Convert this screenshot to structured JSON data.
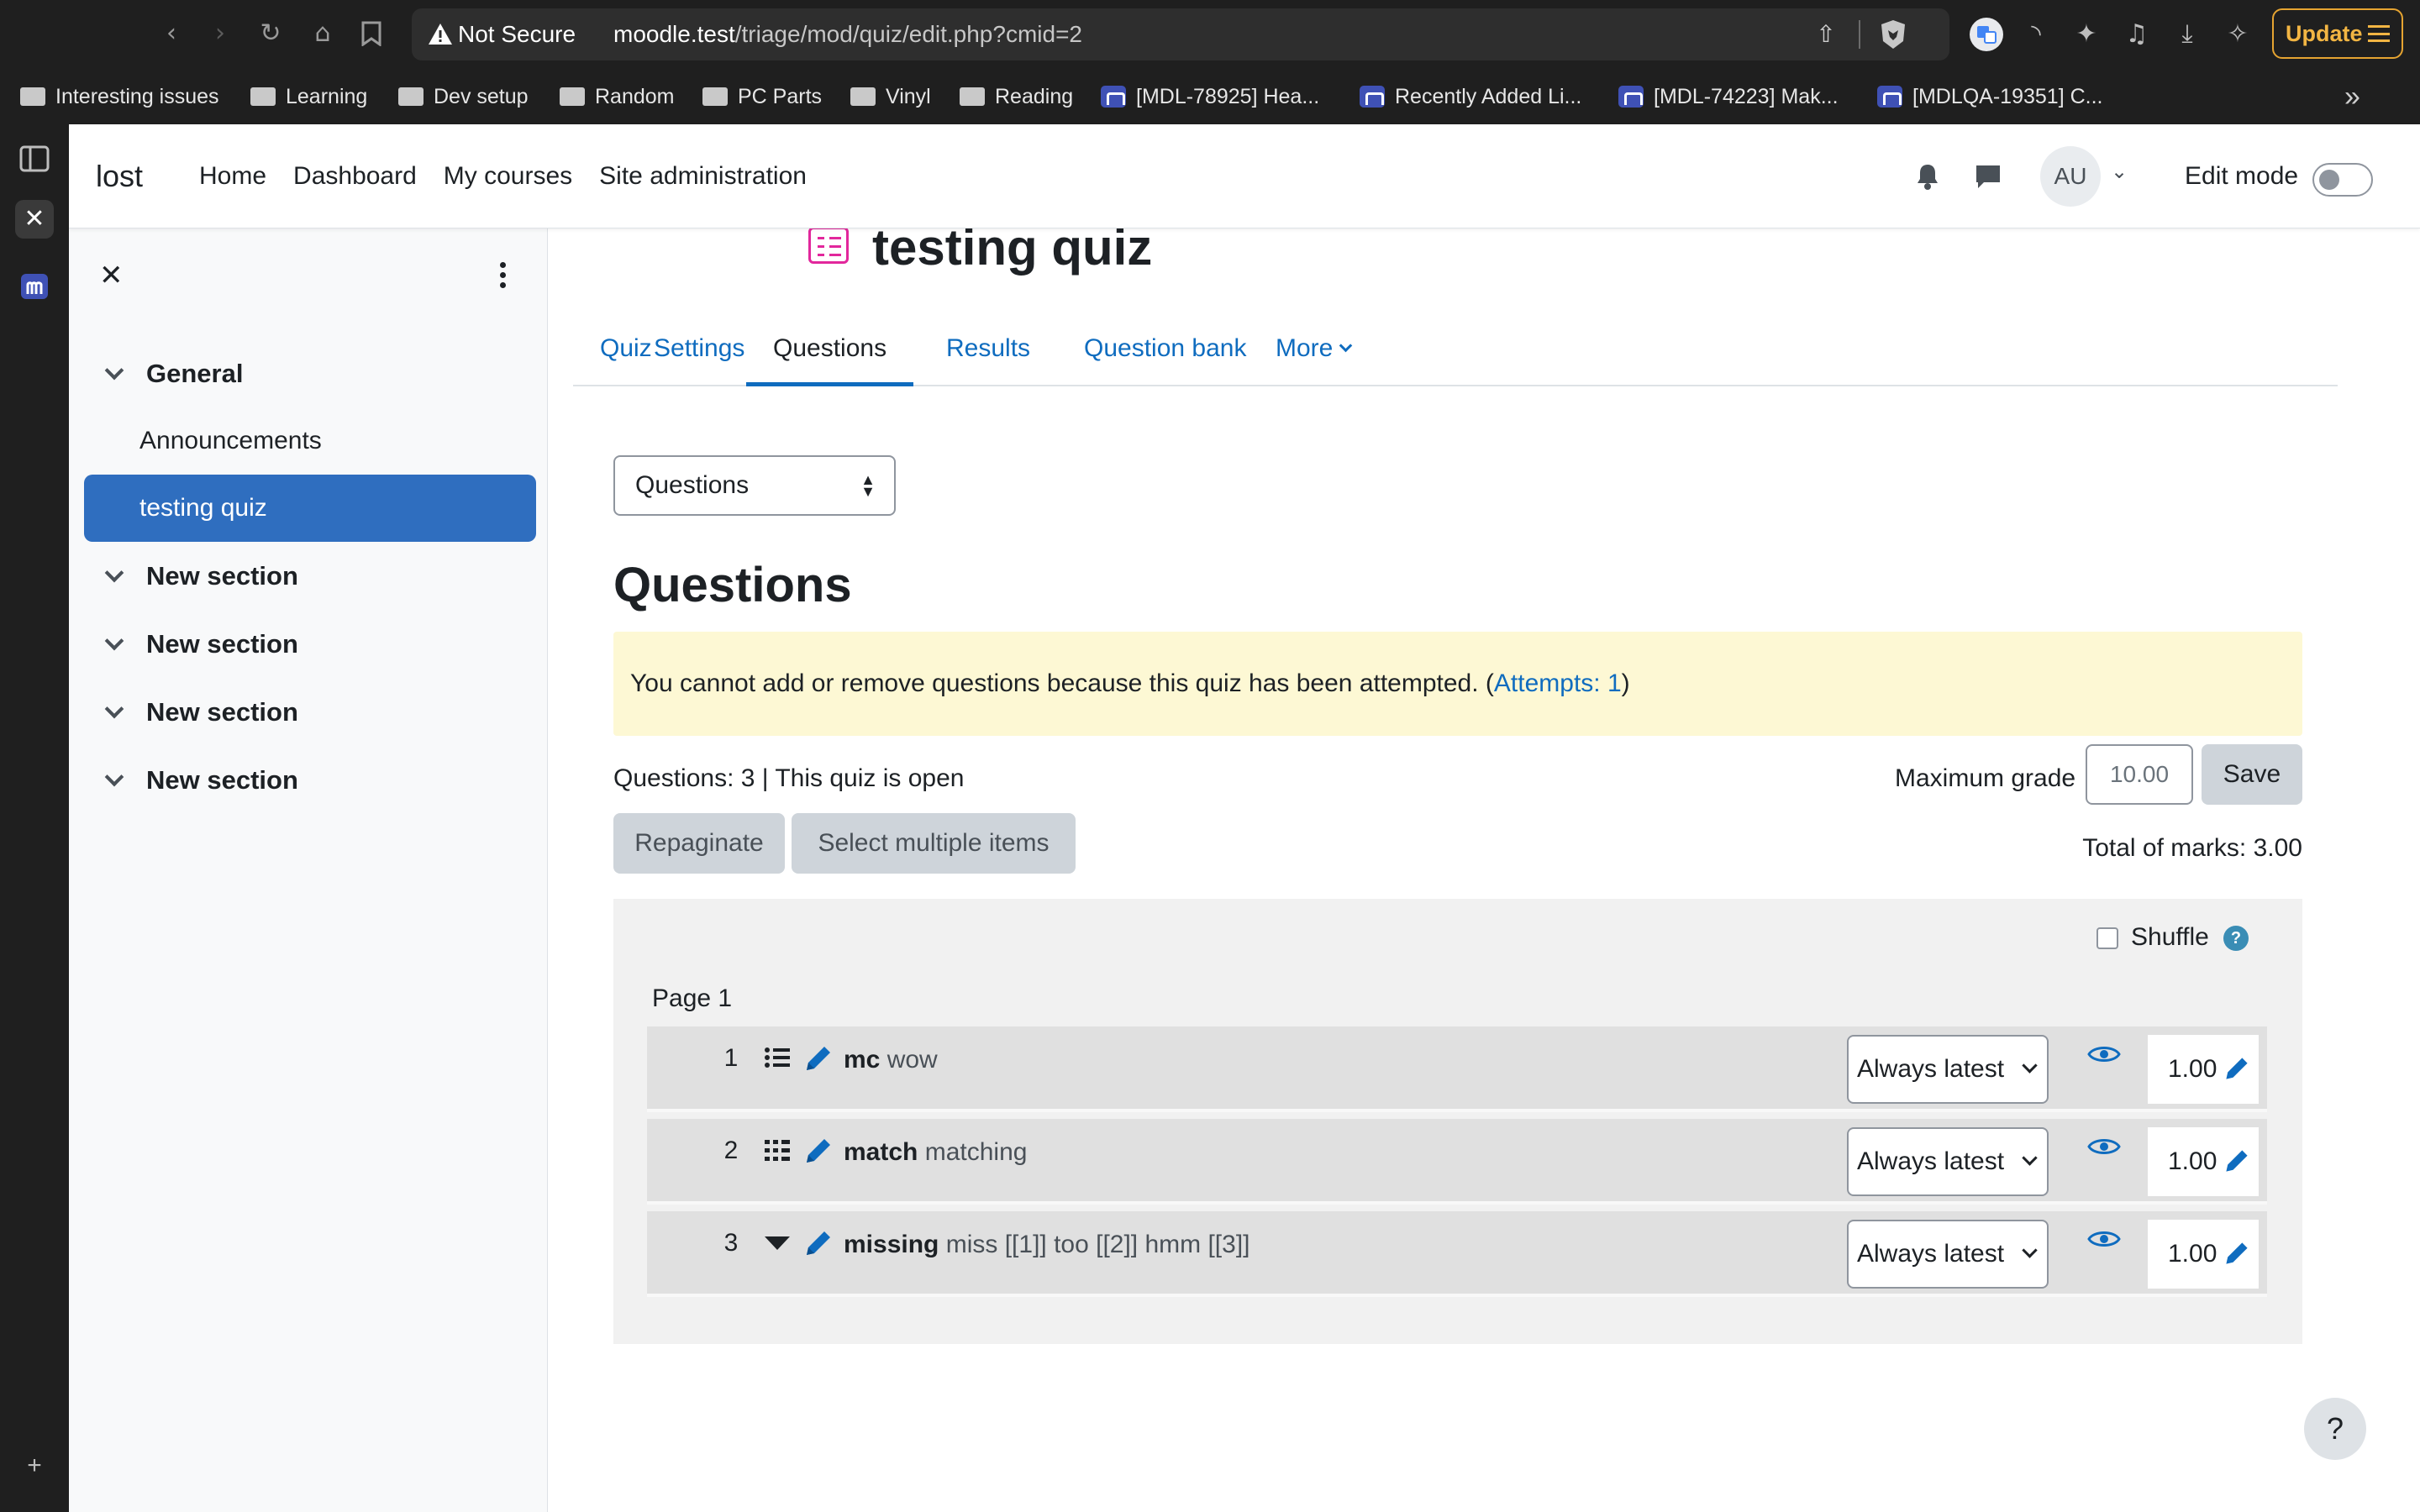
{
  "browser": {
    "not_secure_label": "Not Secure",
    "url_host": "moodle.test",
    "url_path": "/triage/mod/quiz/edit.php?cmid=2",
    "update_label": "Update",
    "bookmarks": [
      {
        "label": "Interesting issues",
        "icon": "folder-icon"
      },
      {
        "label": "Learning",
        "icon": "folder-icon"
      },
      {
        "label": "Dev setup",
        "icon": "folder-icon"
      },
      {
        "label": "Random",
        "icon": "folder-icon"
      },
      {
        "label": "PC Parts",
        "icon": "folder-icon"
      },
      {
        "label": "Vinyl",
        "icon": "folder-icon"
      },
      {
        "label": "Reading",
        "icon": "folder-icon"
      },
      {
        "label": "[MDL-78925] Hea...",
        "icon": "moodle-icon"
      },
      {
        "label": "Recently Added Li...",
        "icon": "moodle-icon"
      },
      {
        "label": "[MDL-74223] Mak...",
        "icon": "moodle-icon"
      },
      {
        "label": "[MDLQA-19351] C...",
        "icon": "moodle-icon"
      }
    ]
  },
  "navbar": {
    "brand": "lost",
    "links": [
      "Home",
      "Dashboard",
      "My courses",
      "Site administration"
    ],
    "avatar_initials": "AU",
    "edit_mode_label": "Edit mode",
    "edit_mode_on": false
  },
  "course_index": {
    "sections": [
      {
        "title": "General",
        "activities": [
          "Announcements",
          "testing quiz"
        ]
      },
      {
        "title": "New section",
        "activities": []
      },
      {
        "title": "New section",
        "activities": []
      },
      {
        "title": "New section",
        "activities": []
      },
      {
        "title": "New section",
        "activities": []
      }
    ],
    "active_activity": "testing quiz"
  },
  "page": {
    "title": "testing quiz",
    "tabs": [
      "Quiz",
      "Settings",
      "Questions",
      "Results",
      "Question bank",
      "More"
    ],
    "active_tab": "Questions",
    "page_select_value": "Questions",
    "heading": "Questions",
    "alert_text": "You cannot add or remove questions because this quiz has been attempted. (",
    "alert_link": "Attempts: 1",
    "alert_suffix": ")",
    "status_text": "Questions: 3 | This quiz is open",
    "max_grade_label": "Maximum grade",
    "max_grade_value": "10.00",
    "save_label": "Save",
    "repaginate_label": "Repaginate",
    "select_multiple_label": "Select multiple items",
    "total_marks": "Total of marks: 3.00",
    "shuffle_label": "Shuffle",
    "shuffle_checked": false,
    "page_label": "Page 1",
    "questions": [
      {
        "number": "1",
        "type_icon": "multichoice-icon",
        "name": "mc",
        "text": "wow",
        "version": "Always latest",
        "mark": "1.00"
      },
      {
        "number": "2",
        "type_icon": "matching-icon",
        "name": "match",
        "text": "matching",
        "version": "Always latest",
        "mark": "1.00"
      },
      {
        "number": "3",
        "type_icon": "gapselect-icon",
        "name": "missing",
        "text": "miss [[1]] too [[2]] hmm [[3]]",
        "version": "Always latest",
        "mark": "1.00"
      }
    ]
  },
  "colors": {
    "brand_primary": "#0f6cbf",
    "active_item_bg": "#2f6ebf",
    "alert_bg": "#fdf8d4",
    "quiz_icon": "#e2279c",
    "update_accent": "#f2b543"
  }
}
